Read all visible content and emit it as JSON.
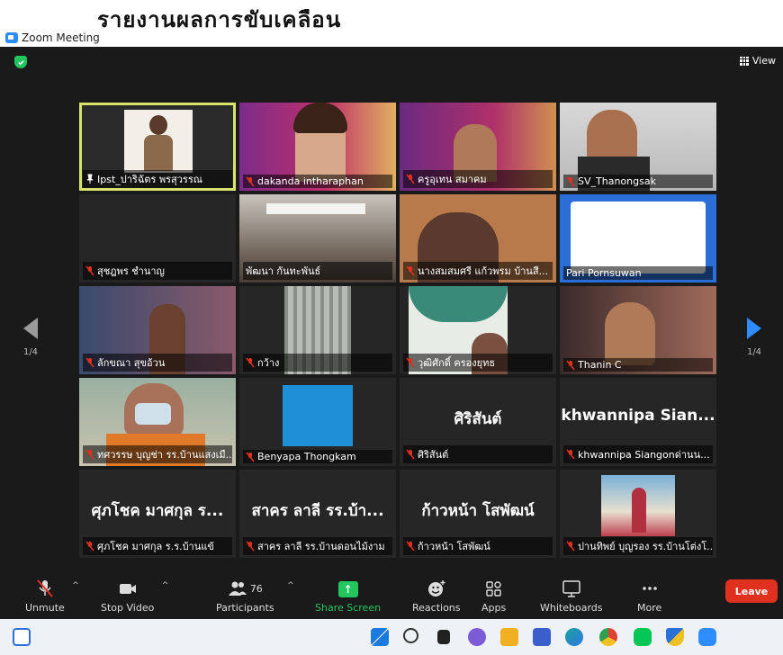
{
  "overlay_title": "รายงานผลการขับเคลื่อน",
  "window": {
    "title": "Zoom Meeting"
  },
  "view_button": "View",
  "pager": {
    "left": "1/4",
    "right": "1/4"
  },
  "participants": [
    {
      "name": "Ipst_ปาริฉัตร พรสุวรรณ",
      "muted": false
    },
    {
      "name": "dakanda intharaphan",
      "muted": true
    },
    {
      "name": "ครูอุเทน สมาคม",
      "muted": true
    },
    {
      "name": "SV_Thanongsak",
      "muted": true
    },
    {
      "name": "สุชฎพร ชำนาญ",
      "muted": true
    },
    {
      "name": "พัฒนา กันทะพันธ์",
      "muted": false
    },
    {
      "name": "นางสมสมศรี แก้วพรม บ้านสี...",
      "muted": true
    },
    {
      "name": "Pari Pornsuwan",
      "muted": false
    },
    {
      "name": "ลักขณา สุขอ้วน",
      "muted": true
    },
    {
      "name": "กว้าง",
      "muted": true
    },
    {
      "name": "วุฒิศักดิ์ ครองยุทธ",
      "muted": true
    },
    {
      "name": "Thanin C",
      "muted": true
    },
    {
      "name": "ทศวรรษ บุญช่า รร.บ้านแสงเมื...",
      "muted": true
    },
    {
      "name": "Benyapa Thongkam",
      "muted": true
    },
    {
      "name": "ศิริสันต์",
      "muted": true,
      "big": "ศิริสันต์"
    },
    {
      "name": "khwannipa Siangonด่านน...",
      "muted": true,
      "big": "khwannipa Sian..."
    },
    {
      "name": "ศุภโชค มาศกุล ร.ร.บ้านแข้",
      "muted": true,
      "big": "ศุภโชค มาศกุล ร..."
    },
    {
      "name": "สาคร ลาลี รร.บ้านดอนไม้งาม",
      "muted": true,
      "big": "สาคร ลาลี รร.บ้า..."
    },
    {
      "name": "ก้าวหน้า โสพัฒน์",
      "muted": true,
      "big": "ก้าวหน้า โสพัฒน์"
    },
    {
      "name": "ปานทิพย์ บุญรอง รร.บ้านโต่งโ...",
      "muted": true
    }
  ],
  "toolbar": {
    "unmute": "Unmute",
    "stop_video": "Stop Video",
    "participants": "Participants",
    "participants_count": "76",
    "share_screen": "Share Screen",
    "reactions": "Reactions",
    "apps": "Apps",
    "whiteboards": "Whiteboards",
    "more": "More",
    "leave": "Leave"
  },
  "colors": {
    "accent_green": "#22c55e",
    "leave_red": "#e0301e",
    "active_speaker": "#d9e36a",
    "zoom_blue": "#2d8cff"
  }
}
